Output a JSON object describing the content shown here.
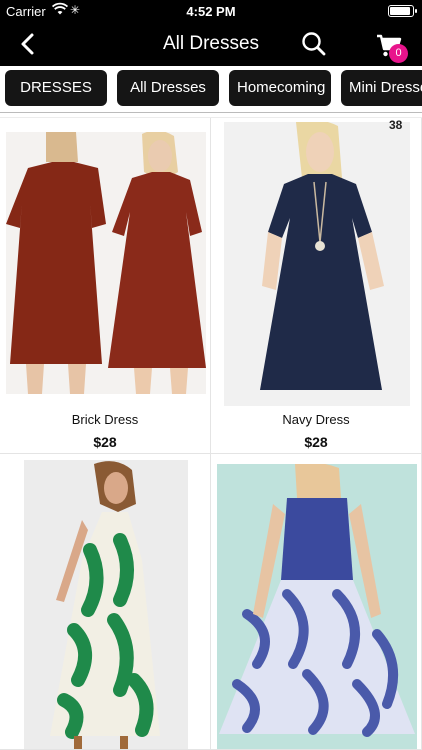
{
  "status_bar": {
    "carrier": "Carrier",
    "time": "4:52 PM",
    "battery_level": 1.0
  },
  "nav": {
    "title": "All Dresses",
    "back_icon": "chevron-left-icon",
    "search_icon": "search-icon",
    "cart_icon": "cart-icon",
    "cart_count": "0"
  },
  "filters": [
    {
      "label": "DRESSES"
    },
    {
      "label": "All Dresses"
    },
    {
      "label": "Homecoming"
    },
    {
      "label": "Mini Dresses"
    }
  ],
  "products": [
    {
      "name": "Brick Dress",
      "price": "$28",
      "color": "#8a2a1a"
    },
    {
      "name": "Navy Dress",
      "price": "$28",
      "color": "#1f2a48",
      "corner_tag": "38"
    },
    {
      "name": "",
      "price": "",
      "color": "#1f8a4a"
    },
    {
      "name": "",
      "price": "",
      "color": "#3a4a9a"
    }
  ],
  "colors": {
    "bar": "#000000",
    "chip": "#151515",
    "badge": "#e8148c"
  }
}
